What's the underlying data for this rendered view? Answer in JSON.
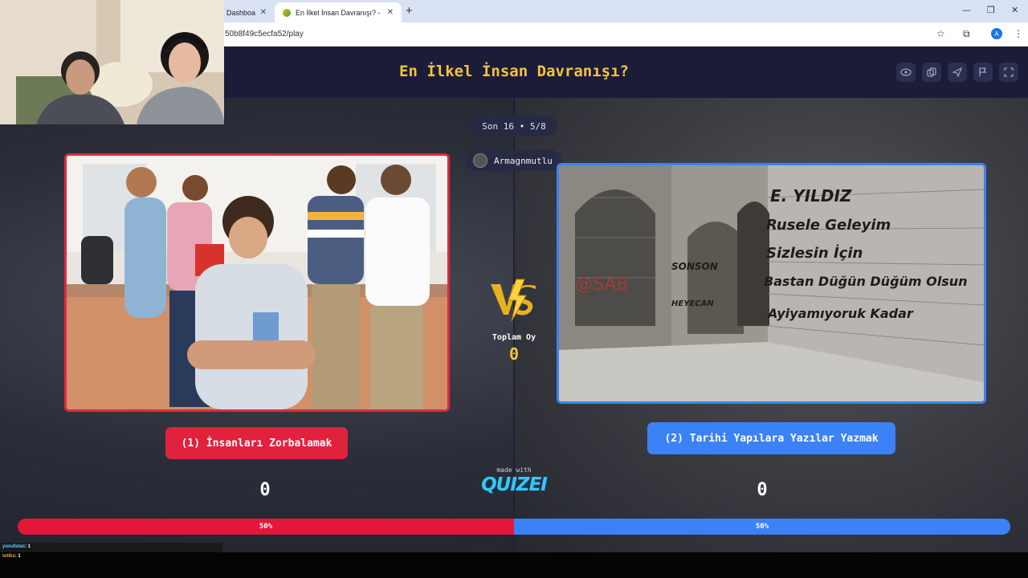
{
  "browser": {
    "tabs": [
      {
        "label": "Dashboard"
      },
      {
        "label": "En İlkel İnsan Davranışı? - Tier L"
      }
    ],
    "url": "50b8f49c5ecfa52/play",
    "profile_initial": "A"
  },
  "game": {
    "title": "En İlkel İnsan Davranışı?",
    "round": "Son 16 • 5/8",
    "creator": "Armagnmutlu",
    "total_votes_label": "Toplam Oy",
    "total_votes": "0",
    "made_with": "made with",
    "brand": "QUIZEI",
    "options": [
      {
        "label": "(1) İnsanları Zorbalamak",
        "score": "0",
        "percent_label": "50%",
        "share": 0.5,
        "color": "#e3173a",
        "image": "bullying-photo"
      },
      {
        "label": "(2) Tarihi Yapılara Yazılar Yazmak",
        "score": "0",
        "percent_label": "50%",
        "share": 0.5,
        "color": "#3b82f6",
        "image": "graffiti-wall-photo"
      }
    ],
    "graffiti_text": [
      "E. YILDIZ",
      "Rusele Geleyim",
      "Sizlesin İçin",
      "Bastan Düğün Düğüm Olsun",
      "Ayiyamıyoruk Kadar",
      "SONSON",
      "HEYECAN"
    ],
    "toolbar_icons": [
      "eye-icon",
      "copy-icon",
      "send-icon",
      "flag-icon",
      "fullscreen-icon"
    ]
  },
  "chat": [
    {
      "user": "yusufatas",
      "message": ": 1"
    },
    {
      "user": "tetiks",
      "message": ": 1"
    }
  ]
}
